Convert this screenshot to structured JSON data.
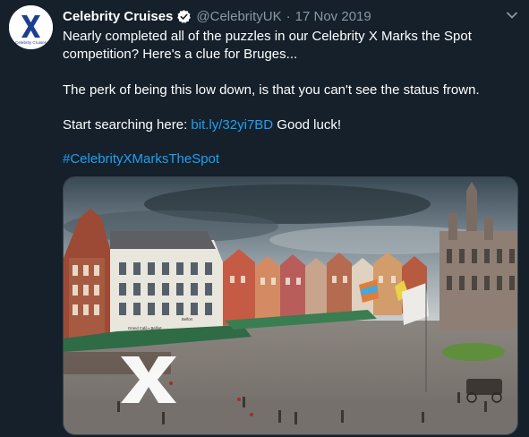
{
  "tweet": {
    "avatar_text": "Celebrity Cruises",
    "display_name": "Celebrity Cruises",
    "handle": "@CelebrityUK",
    "separator": "·",
    "date": "17 Nov 2019",
    "paragraph_1": "Nearly completed all of the puzzles in our Celebrity X Marks the Spot competition? Here's a clue for Bruges...",
    "paragraph_2": "The perk of being this low down, is that you can't see the status frown.",
    "paragraph_3_prefix": "Start searching here: ",
    "paragraph_3_link": "bit.ly/32yi7BD",
    "paragraph_3_suffix": " Good luck!",
    "hashtag": "#CelebrityXMarksTheSpot",
    "image_sign_1": "Grand Café ▪ Belfort",
    "image_sign_2": "Belfort"
  },
  "colors": {
    "background": "#15202b",
    "text": "#ffffff",
    "muted": "#8899a6",
    "link": "#1da1f2",
    "brand_navy": "#1d3f8f"
  },
  "icons": {
    "verified": "verified-badge-icon",
    "caret": "chevron-down-icon",
    "logo": "celebrity-x-logo-icon"
  }
}
